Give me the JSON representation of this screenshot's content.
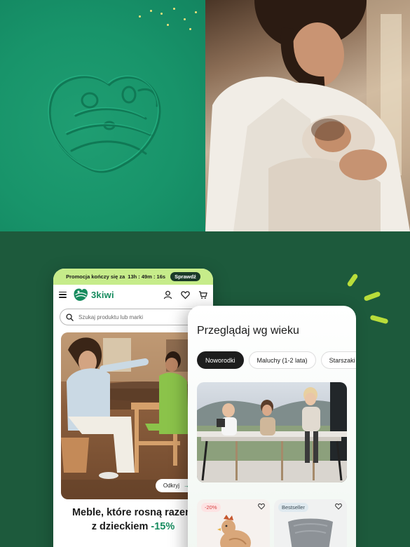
{
  "promo": {
    "label": "Promocja kończy się za",
    "timer": "13h : 49m : 16s",
    "button": "Sprawdź"
  },
  "brand": {
    "name": "3kiwi"
  },
  "nav": {
    "icons": [
      "menu-icon",
      "user-icon",
      "heart-icon",
      "cart-icon"
    ]
  },
  "search": {
    "placeholder": "Szukaj produktu lub marki"
  },
  "banner": {
    "button": "Odkryj",
    "headline_line1": "Meble, które rosną razem",
    "headline_line2_prefix": "z dzieckiem",
    "headline_discount": "-15%"
  },
  "browse": {
    "title": "Przeglądaj wg wieku",
    "chips": [
      "Noworodki",
      "Maluchy (1-2 lata)",
      "Starszaki"
    ],
    "active_chip": "Noworodki"
  },
  "products": [
    {
      "badge": "-20%"
    },
    {
      "badge": "Bestseller"
    }
  ],
  "colors": {
    "brand_green": "#168b5e",
    "background_dark": "#1d5a3c",
    "promo_bar": "#c6ec8a",
    "accent_lime": "#b9dd3a"
  }
}
